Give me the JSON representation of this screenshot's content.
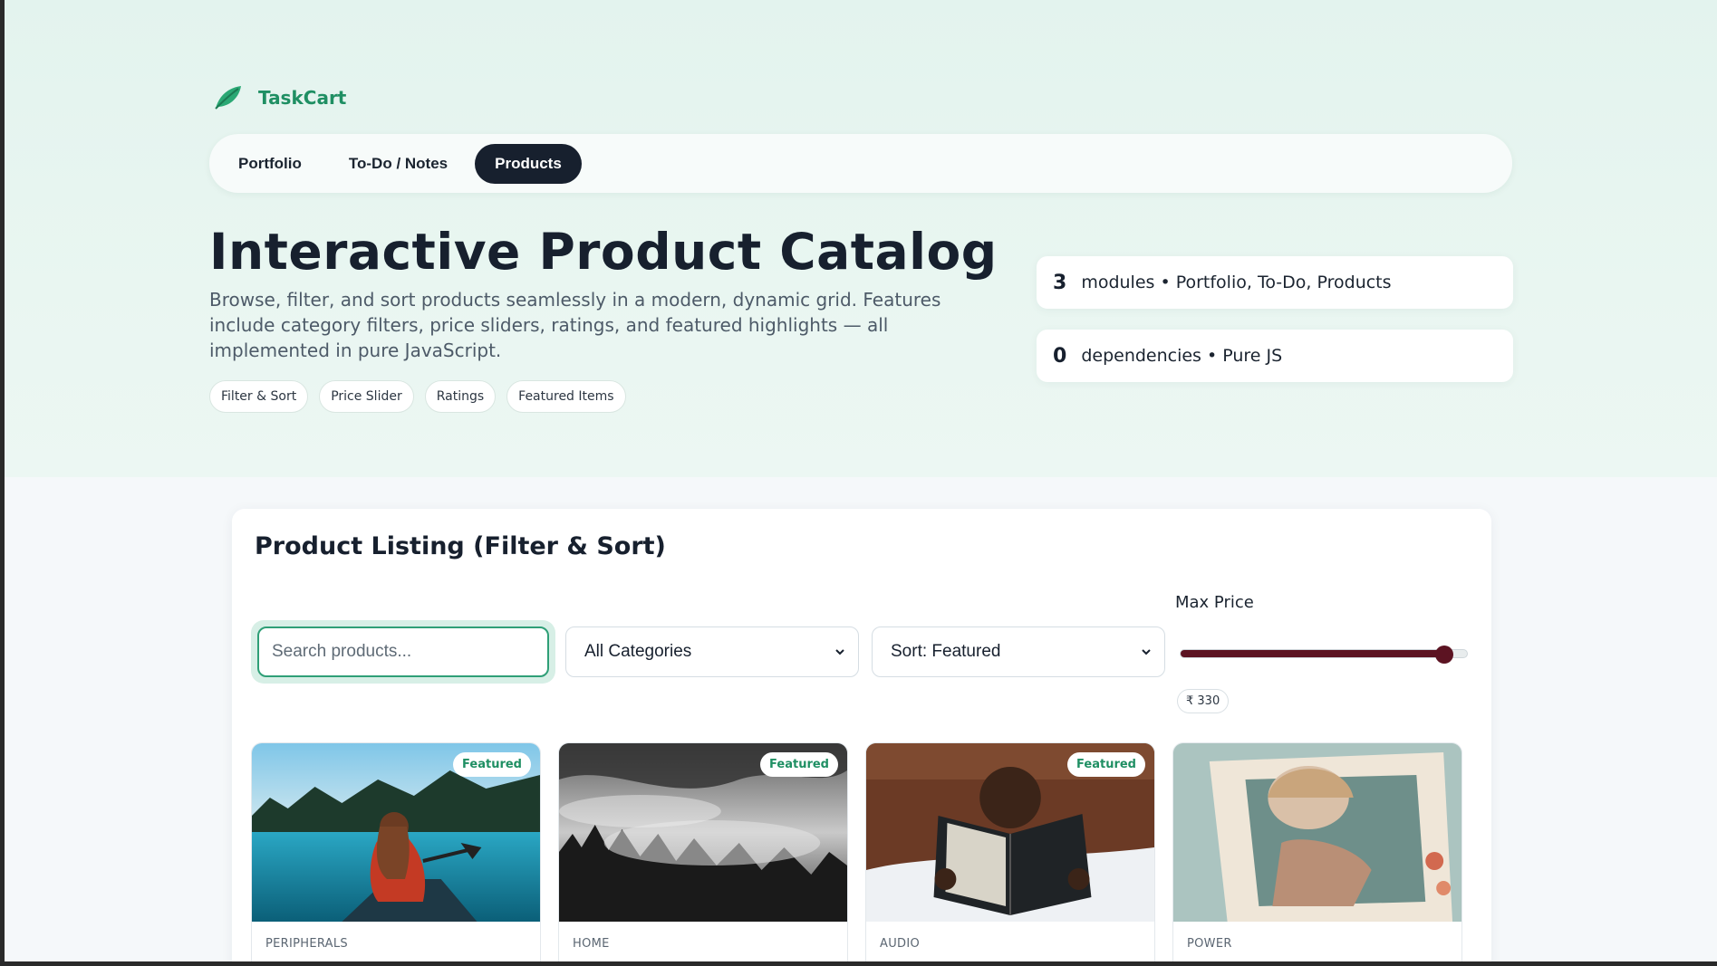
{
  "brand": {
    "name": "TaskCart",
    "logo_icon": "leaf-icon",
    "accent": "#1f8f63"
  },
  "nav": {
    "tabs": [
      {
        "label": "Portfolio",
        "active": false
      },
      {
        "label": "To-Do / Notes",
        "active": false
      },
      {
        "label": "Products",
        "active": true
      }
    ]
  },
  "hero": {
    "title": "Interactive Product Catalog",
    "description": "Browse, filter, and sort products seamlessly in a modern, dynamic grid. Features include category filters, price sliders, ratings, and featured highlights — all implemented in pure JavaScript.",
    "chips": [
      "Filter & Sort",
      "Price Slider",
      "Ratings",
      "Featured Items"
    ],
    "stats": [
      {
        "number": "3",
        "label": "modules • Portfolio, To-Do, Products"
      },
      {
        "number": "0",
        "label": "dependencies • Pure JS"
      }
    ]
  },
  "listing": {
    "title": "Product Listing (Filter & Sort)",
    "search_placeholder": "Search products...",
    "search_value": "",
    "category_select": "All Categories",
    "sort_select": "Sort: Featured",
    "price_label": "Max Price",
    "price_value_text": "₹ 330",
    "price_fraction": 0.92,
    "slider_color": "#5c1322",
    "products": [
      {
        "category": "PERIPHERALS",
        "badge": "Featured",
        "image": "woman-in-canoe-on-lake"
      },
      {
        "category": "HOME",
        "badge": "Featured",
        "image": "misty-forest-black-and-white"
      },
      {
        "category": "AUDIO",
        "badge": "Featured",
        "image": "child-reading-holy-bible"
      },
      {
        "category": "POWER",
        "badge": "",
        "image": "woman-at-vintage-car-window"
      }
    ]
  }
}
